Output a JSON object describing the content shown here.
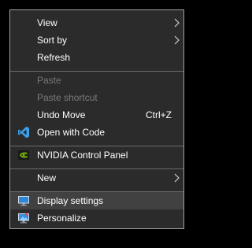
{
  "menu": {
    "items": [
      {
        "label": "View"
      },
      {
        "label": "Sort by"
      },
      {
        "label": "Refresh"
      },
      {
        "label": "Paste"
      },
      {
        "label": "Paste shortcut"
      },
      {
        "label": "Undo Move",
        "shortcut": "Ctrl+Z"
      },
      {
        "label": "Open with Code",
        "icon": "vscode-icon"
      },
      {
        "label": "NVIDIA Control Panel",
        "icon": "nvidia-icon"
      },
      {
        "label": "New"
      },
      {
        "label": "Display settings",
        "icon": "display-icon"
      },
      {
        "label": "Personalize",
        "icon": "personalize-icon"
      }
    ]
  },
  "colors": {
    "menu_bg": "#2b2b2b",
    "hover_bg": "#414141",
    "text": "#ffffff",
    "disabled_text": "#7a7a7a",
    "vscode_blue": "#3ca0ea",
    "nvidia_green": "#76b900"
  }
}
